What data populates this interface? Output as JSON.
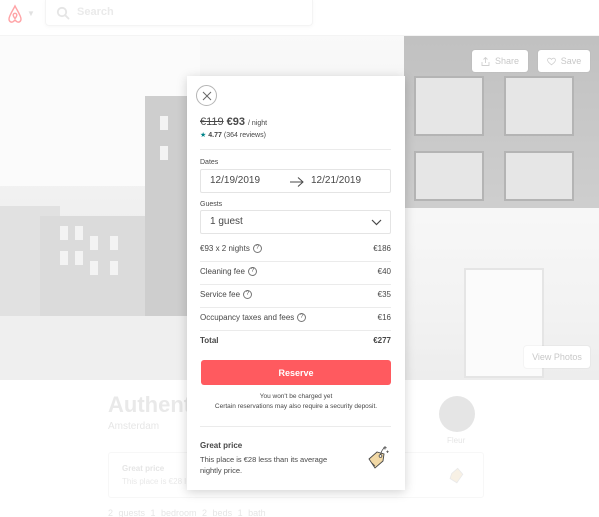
{
  "header": {
    "search_placeholder": "Search",
    "logo_icon": "airbnb-logo-icon",
    "caret_icon": "chevron-down-icon"
  },
  "hero": {
    "share_label": "Share",
    "save_label": "Save",
    "view_photos_label": "View Photos"
  },
  "listing": {
    "title": "Authentic",
    "city": "Amsterdam",
    "host_name": "Fleur",
    "card_title": "Great price",
    "card_desc": "This place is €28 l",
    "stats": "2 guests   1 bedroom   2 beds   1 bath"
  },
  "booking": {
    "old_price": "€119",
    "new_price": "€93",
    "per_night": "/ night",
    "rating": "4.77",
    "reviews": "(364 reviews)",
    "dates_label": "Dates",
    "check_in": "12/19/2019",
    "check_out": "12/21/2019",
    "guests_label": "Guests",
    "guests_value": "1 guest",
    "fees": [
      {
        "label": "€93 x 2 nights",
        "amount": "€186"
      },
      {
        "label": "Cleaning fee",
        "amount": "€40"
      },
      {
        "label": "Service fee",
        "amount": "€35"
      },
      {
        "label": "Occupancy taxes and fees",
        "amount": "€16"
      }
    ],
    "total_label": "Total",
    "total_amount": "€277",
    "reserve_label": "Reserve",
    "note_line1": "You won't be charged yet",
    "note_line2": "Certain reservations may also require a security deposit.",
    "great_price_title": "Great price",
    "great_price_desc": "This place is €28 less than its average nightly price."
  },
  "colors": {
    "brand": "#ff5a5f",
    "rating_star": "#008489",
    "text": "#484848"
  }
}
